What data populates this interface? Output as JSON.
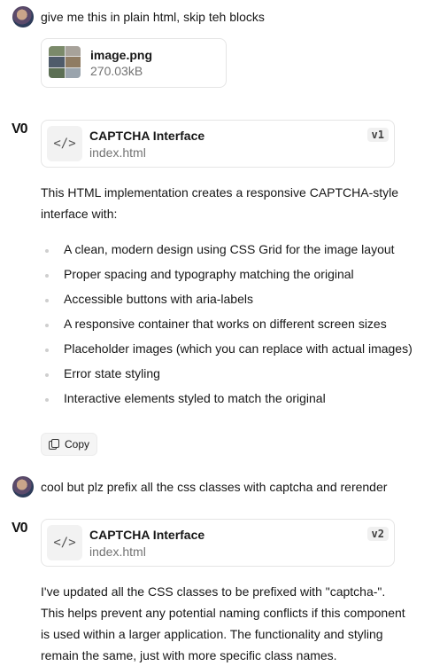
{
  "messages": {
    "user1": {
      "text": "give me this in plain html, skip teh blocks"
    },
    "attachment": {
      "name": "image.png",
      "size": "270.03kB"
    },
    "assistant1": {
      "logo": "V0",
      "artifact": {
        "icon": "</>",
        "title": "CAPTCHA Interface",
        "file": "index.html",
        "version": "v1"
      },
      "intro": "This HTML implementation creates a responsive CAPTCHA-style interface with:",
      "bullets": [
        "A clean, modern design using CSS Grid for the image layout",
        "Proper spacing and typography matching the original",
        "Accessible buttons with aria-labels",
        "A responsive container that works on different screen sizes",
        "Placeholder images (which you can replace with actual images)",
        "Error state styling",
        "Interactive elements styled to match the original"
      ],
      "copy_label": "Copy"
    },
    "user2": {
      "text": "cool but plz prefix all the css classes with captcha and rerender"
    },
    "assistant2": {
      "logo": "V0",
      "artifact": {
        "icon": "</>",
        "title": "CAPTCHA Interface",
        "file": "index.html",
        "version": "v2"
      },
      "paragraph_lines": [
        "I've updated all the CSS classes to be prefixed with \"captcha-\".",
        "This helps prevent any potential naming conflicts if this component",
        "is used within a larger application. The functionality and styling",
        "remain the same, just with more specific class names."
      ]
    }
  }
}
